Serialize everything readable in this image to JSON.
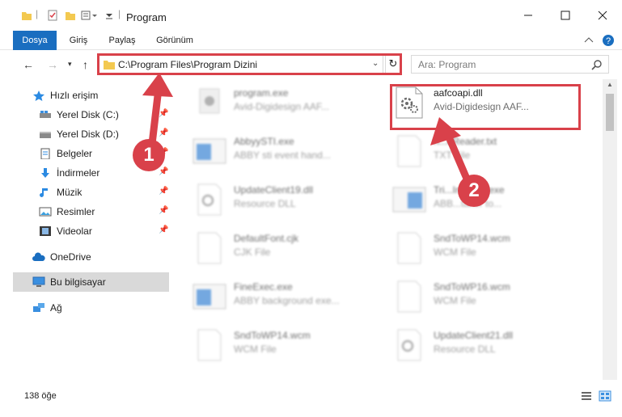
{
  "window": {
    "title": "Program",
    "controls": [
      "minimize-icon",
      "maximize-icon",
      "close-icon"
    ]
  },
  "ribbon": {
    "tabs": [
      "Dosya",
      "Giriş",
      "Paylaş",
      "Görünüm"
    ]
  },
  "address": {
    "path": "C:\\Program Files\\Program Dizini"
  },
  "search": {
    "placeholder": "Ara: Program"
  },
  "sidebar": {
    "items": [
      {
        "label": "Hızlı erişim",
        "icon": "star-icon"
      },
      {
        "label": "Yerel Disk (C:)",
        "icon": "drive-icon",
        "pinned": true
      },
      {
        "label": "Yerel Disk (D:)",
        "icon": "drive-icon",
        "pinned": true
      },
      {
        "label": "Belgeler",
        "icon": "documents-icon",
        "pinned": true
      },
      {
        "label": "İndirmeler",
        "icon": "download-icon",
        "pinned": true
      },
      {
        "label": "Müzik",
        "icon": "music-icon",
        "pinned": true
      },
      {
        "label": "Resimler",
        "icon": "pictures-icon",
        "pinned": true
      },
      {
        "label": "Videolar",
        "icon": "videos-icon",
        "pinned": true
      },
      {
        "label": "OneDrive",
        "icon": "cloud-icon"
      },
      {
        "label": "Bu bilgisayar",
        "icon": "computer-icon",
        "selected": true
      },
      {
        "label": "Ağ",
        "icon": "network-icon"
      }
    ]
  },
  "files": [
    {
      "name": "program.exe",
      "type": "Avid-Digidesign AAF...",
      "blurred": true
    },
    {
      "name": "aafcoapi.dll",
      "type": "Avid-Digidesign AAF...",
      "blurred": false
    },
    {
      "name": "AbbyySTI.exe",
      "type": "ABBY sti event hand...",
      "blurred": true
    },
    {
      "name": "h...eReader.txt",
      "type": "TXT File",
      "blurred": true
    },
    {
      "name": "UpdateClient19.dll",
      "type": "Resource DLL",
      "blurred": true
    },
    {
      "name": "Tri...Installer.exe",
      "type": "ABB...taker to...",
      "blurred": true
    },
    {
      "name": "DefaultFont.cjk",
      "type": "CJK File",
      "blurred": true
    },
    {
      "name": "SndToWP14.wcm",
      "type": "WCM File",
      "blurred": true
    },
    {
      "name": "FineExec.exe",
      "type": "ABBY background exe...",
      "blurred": true
    },
    {
      "name": "SndToWP16.wcm",
      "type": "WCM File",
      "blurred": true
    },
    {
      "name": "SndToWP14.wcm",
      "type": "WCM File",
      "blurred": true
    },
    {
      "name": "UpdateClient21.dll",
      "type": "Resource DLL",
      "blurred": true
    }
  ],
  "status": {
    "item_count": "138 öğe"
  },
  "annotations": [
    {
      "number": "1"
    },
    {
      "number": "2"
    }
  ],
  "colors": {
    "accent": "#1a6ec0",
    "annotation_red": "#d9414a",
    "selected_bg": "#d9d9d9"
  }
}
